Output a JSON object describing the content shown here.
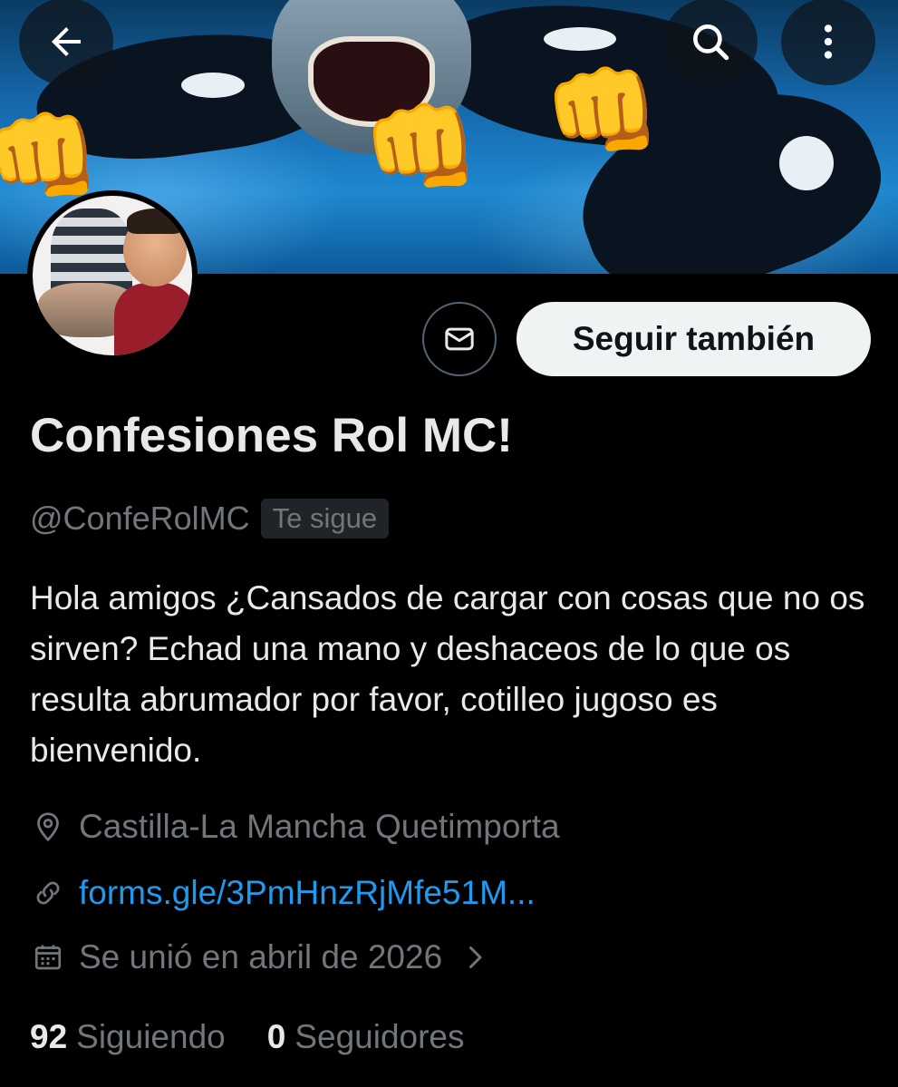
{
  "header": {
    "banner_icon": "banner-image",
    "back_icon": "arrow-left-icon",
    "search_icon": "search-icon",
    "more_icon": "more-vertical-icon"
  },
  "actions": {
    "message_icon": "envelope-icon",
    "follow_label": "Seguir también"
  },
  "profile": {
    "display_name": "Confesiones Rol MC!",
    "handle": "@ConfeRolMC",
    "follows_you_badge": "Te sigue",
    "bio": "Hola amigos ¿Cansados de cargar con cosas que no os sirven? Echad una mano y deshaceos de lo que os resulta abrumador por favor, cotilleo jugoso es bienvenido.",
    "location": "Castilla-La Mancha Quetimporta",
    "url": "forms.gle/3PmHnzRjMfe51M...",
    "joined": "Se unió en abril de 2026"
  },
  "stats": {
    "following_count": "92",
    "following_label": "Siguiendo",
    "followers_count": "0",
    "followers_label": "Seguidores"
  },
  "colors": {
    "background": "#000000",
    "primary_text": "#e7e9ea",
    "secondary_text": "#71767b",
    "link": "#1d9bf0",
    "follow_button_bg": "#eff3f4"
  }
}
